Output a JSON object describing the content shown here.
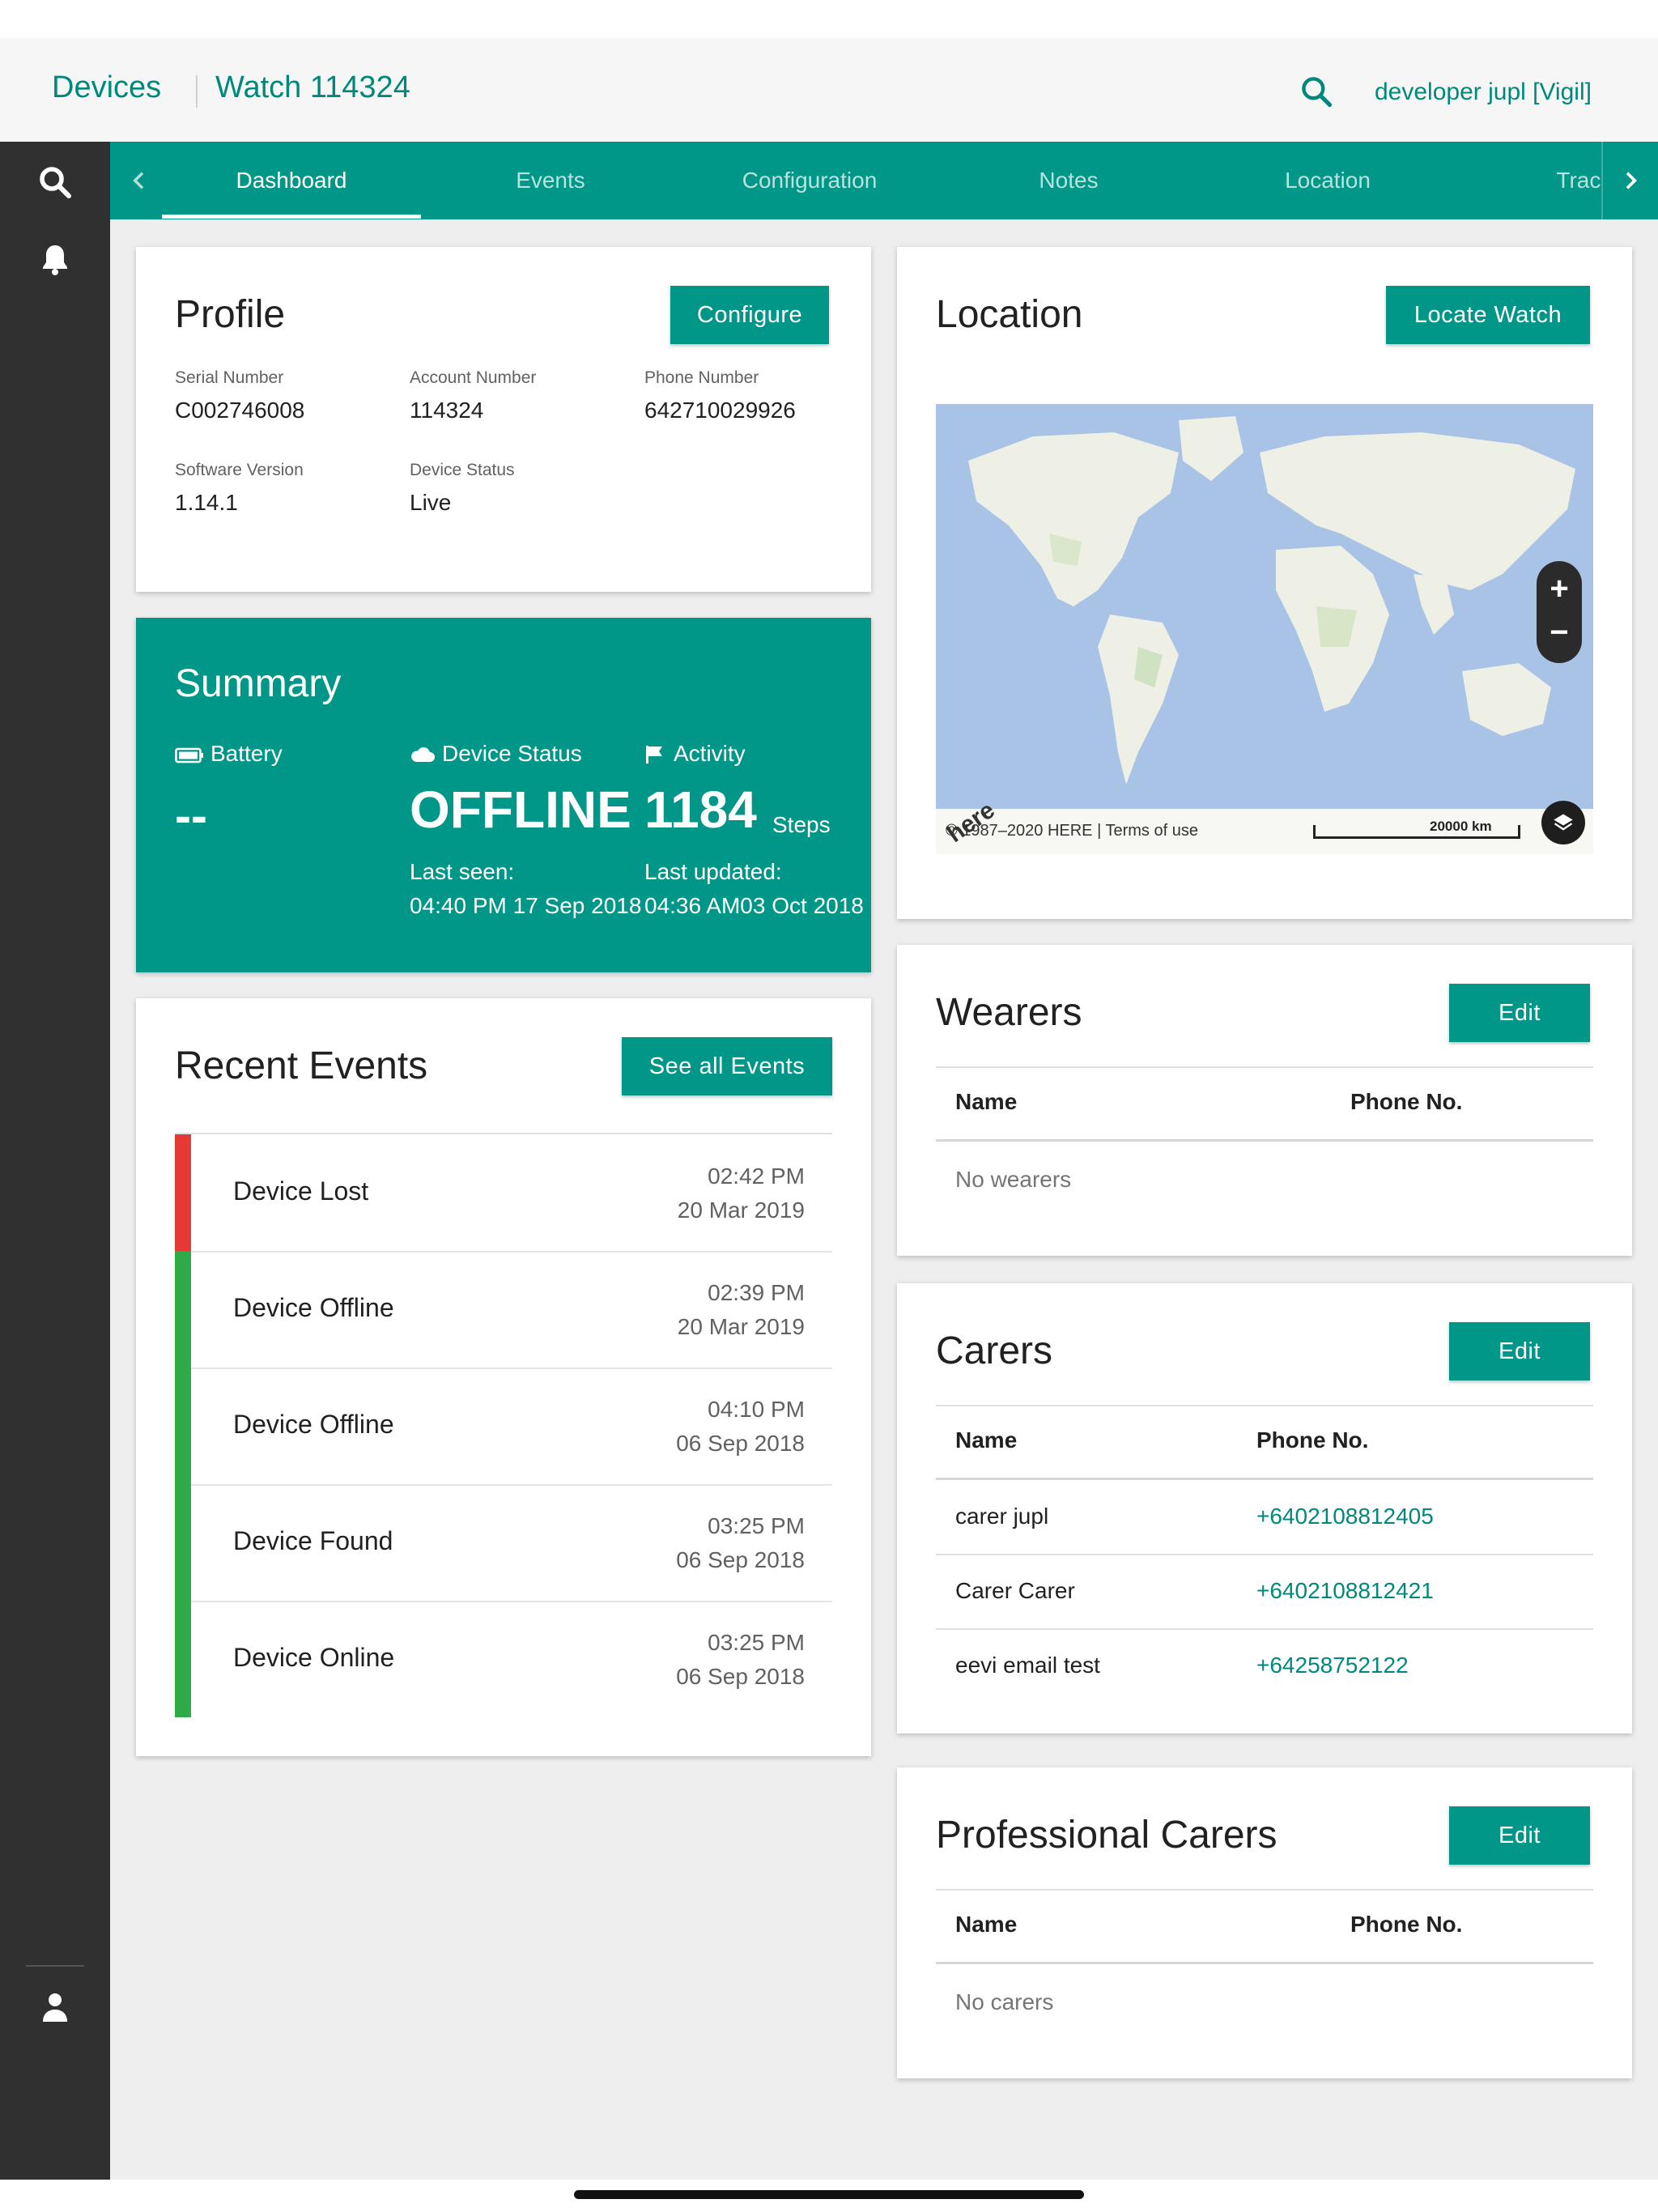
{
  "header": {
    "crumb_devices": "Devices",
    "crumb_device": "Watch 114324",
    "user_label": "developer jupl [Vigil]"
  },
  "sidebar": {
    "icons": [
      "search-icon",
      "bell-icon",
      "user-icon"
    ]
  },
  "tabs": [
    {
      "label": "Dashboard",
      "active": true
    },
    {
      "label": "Events"
    },
    {
      "label": "Configuration"
    },
    {
      "label": "Notes"
    },
    {
      "label": "Location"
    },
    {
      "label": "Tracki"
    }
  ],
  "profile": {
    "title": "Profile",
    "configure_label": "Configure",
    "fields": [
      {
        "label": "Serial Number",
        "value": "C002746008"
      },
      {
        "label": "Account Number",
        "value": "114324"
      },
      {
        "label": "Phone Number",
        "value": "642710029926"
      },
      {
        "label": "Software Version",
        "value": "1.14.1"
      },
      {
        "label": "Device Status",
        "value": "Live"
      }
    ]
  },
  "summary": {
    "title": "Summary",
    "battery_label": "Battery",
    "battery_value": "--",
    "status_label": "Device Status",
    "status_value": "OFFLINE",
    "activity_label": "Activity",
    "activity_value": "1184",
    "activity_unit": "Steps",
    "last_seen_label": "Last seen:",
    "last_seen_value": "04:40 PM 17 Sep 2018",
    "last_updated_label": "Last updated:",
    "last_updated_value": "04:36 AM03 Oct 2018"
  },
  "recent_events": {
    "title": "Recent Events",
    "see_all_label": "See all Events",
    "items": [
      {
        "title": "Device Lost",
        "time": "02:42 PM",
        "date": "20 Mar 2019",
        "color": "#e53935"
      },
      {
        "title": "Device Offline",
        "time": "02:39 PM",
        "date": "20 Mar 2019",
        "color": "#2eaa47"
      },
      {
        "title": "Device Offline",
        "time": "04:10 PM",
        "date": "06 Sep 2018",
        "color": "#2eaa47"
      },
      {
        "title": "Device Found",
        "time": "03:25 PM",
        "date": "06 Sep 2018",
        "color": "#2eaa47"
      },
      {
        "title": "Device Online",
        "time": "03:25 PM",
        "date": "06 Sep 2018",
        "color": "#2eaa47"
      }
    ]
  },
  "location": {
    "title": "Location",
    "locate_label": "Locate Watch",
    "map_logo": "here",
    "copyright": "© 1987–2020 HERE | Terms of use",
    "scale_label": "20000 km",
    "zoom_in": "+",
    "zoom_out": "−"
  },
  "wearers": {
    "title": "Wearers",
    "edit_label": "Edit",
    "col_name": "Name",
    "col_phone": "Phone No.",
    "empty": "No wearers"
  },
  "carers": {
    "title": "Carers",
    "edit_label": "Edit",
    "col_name": "Name",
    "col_phone": "Phone No.",
    "rows": [
      {
        "name": "carer jupl",
        "phone": "+6402108812405"
      },
      {
        "name": "Carer Carer",
        "phone": "+6402108812421"
      },
      {
        "name": "eevi email test",
        "phone": "+64258752122"
      }
    ]
  },
  "professional_carers": {
    "title": "Professional Carers",
    "edit_label": "Edit",
    "col_name": "Name",
    "col_phone": "Phone No.",
    "empty": "No carers"
  },
  "colors": {
    "accent": "#009688",
    "accent_text": "#00897b",
    "sidebar": "#303030",
    "event_red": "#e53935",
    "event_green": "#2eaa47"
  }
}
